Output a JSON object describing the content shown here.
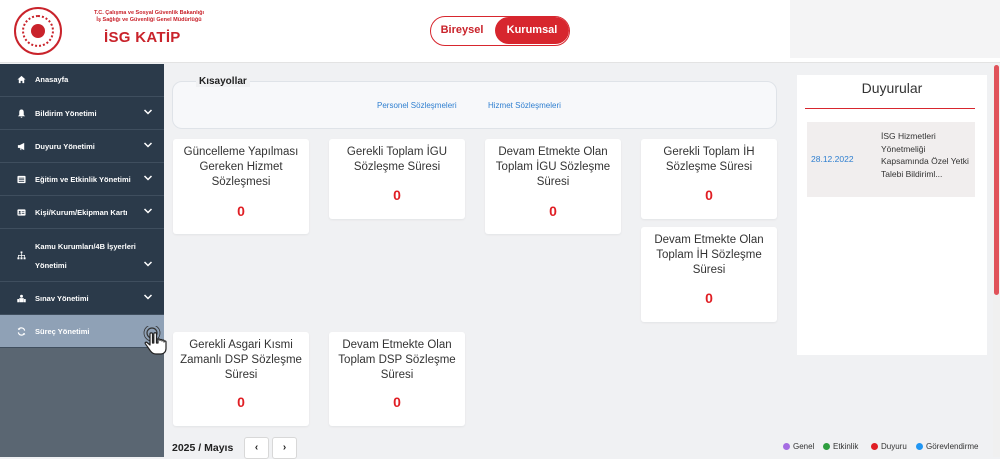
{
  "header": {
    "ministry_line1": "T.C. Çalışma ve Sosyal Güvenlik Bakanlığı",
    "ministry_line2": "İş Sağlığı ve Güvenliği Genel Müdürlüğü",
    "brand": "İSG KATİP",
    "toggle": {
      "individual": "Bireysel",
      "corporate": "Kurumsal",
      "selected": "Kurumsal"
    }
  },
  "sidebar": {
    "items": [
      {
        "label": "Anasayfa",
        "icon": "home-icon"
      },
      {
        "label": "Bildirim Yönetimi",
        "icon": "bell-icon"
      },
      {
        "label": "Duyuru Yönetimi",
        "icon": "megaphone-icon"
      },
      {
        "label": "Eğitim ve Etkinlik Yönetimi",
        "icon": "list-icon"
      },
      {
        "label": "Kişi/Kurum/Ekipman Kartı",
        "icon": "id-card-icon"
      },
      {
        "label_line1": "Kamu Kurumları/4B İşyerleri",
        "label_line2": "Yönetimi",
        "icon": "sitemap-icon"
      },
      {
        "label": "Sınav Yönetimi",
        "icon": "users-icon"
      },
      {
        "label": "Süreç Yönetimi",
        "icon": "refresh-icon"
      }
    ]
  },
  "shortcuts": {
    "title": "Kısayollar",
    "links": [
      "Personel Sözleşmeleri",
      "Hizmet Sözleşmeleri"
    ]
  },
  "cards": [
    {
      "title": "Güncelleme Yapılması Gereken Hizmet Sözleşmesi",
      "value": "0"
    },
    {
      "title": "Gerekli Toplam İGU Sözleşme Süresi",
      "value": "0"
    },
    {
      "title": "Devam Etmekte Olan Toplam İGU Sözleşme Süresi",
      "value": "0"
    },
    {
      "title": "Gerekli Toplam İH Sözleşme Süresi",
      "value": "0"
    },
    {
      "title": "Devam Etmekte Olan Toplam İH Sözleşme Süresi",
      "value": "0"
    },
    {
      "title": "Gerekli Asgari Kısmi Zamanlı DSP Sözleşme Süresi",
      "value": "0"
    },
    {
      "title": "Devam Etmekte Olan Toplam DSP Sözleşme Süresi",
      "value": "0"
    }
  ],
  "calendar": {
    "period": "2025 / Mayıs",
    "prev": "‹",
    "next": "›"
  },
  "announcements": {
    "title": "Duyurular",
    "items": [
      {
        "date": "28.12.2022",
        "text": "İSG Hizmetleri Yönetmeliği Kapsamında Özel Yetki Talebi Bildiriml..."
      }
    ]
  },
  "legend": [
    {
      "label": "Genel",
      "color": "#a56de2"
    },
    {
      "label": "Etkinlik",
      "color": "#2e9e3e"
    },
    {
      "label": "Duyuru",
      "color": "#e01e24"
    },
    {
      "label": "Görevlendirme",
      "color": "#2196f3"
    }
  ],
  "colors": {
    "brand_red": "#d7262e",
    "sidebar_dark": "#2b3a4a",
    "sidebar_active": "#8fa1b6",
    "link_blue": "#2f7fd0"
  }
}
